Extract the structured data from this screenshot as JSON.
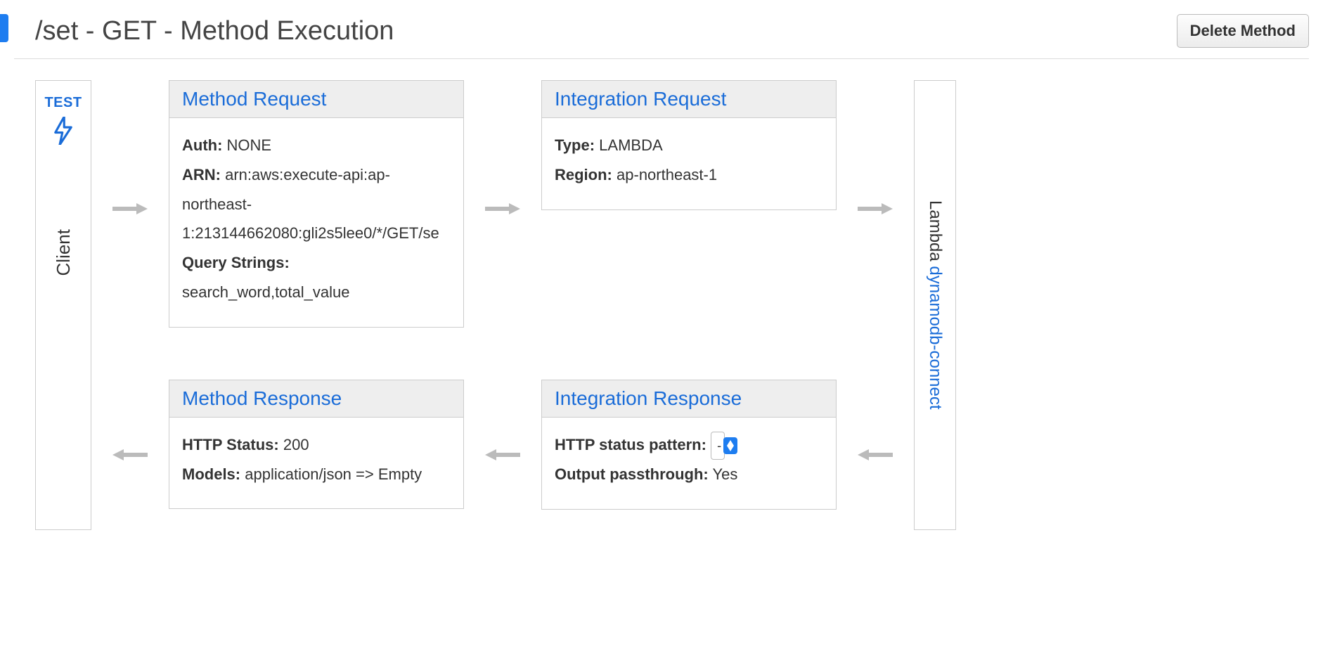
{
  "header": {
    "title": "/set - GET - Method Execution",
    "delete_label": "Delete Method"
  },
  "client": {
    "test_label": "TEST",
    "label": "Client"
  },
  "lambda": {
    "prefix": "Lambda ",
    "link": "dynamodb-connect"
  },
  "method_request": {
    "title": "Method Request",
    "auth_label": "Auth:",
    "auth_value": "NONE",
    "arn_label": "ARN:",
    "arn_value": "arn:aws:execute-api:ap-northeast-1:213144662080:gli2s5lee0/*/GET/se",
    "qs_label": "Query Strings:",
    "qs_value": "search_word,total_value"
  },
  "integration_request": {
    "title": "Integration Request",
    "type_label": "Type:",
    "type_value": "LAMBDA",
    "region_label": "Region:",
    "region_value": "ap-northeast-1"
  },
  "method_response": {
    "title": "Method Response",
    "status_label": "HTTP Status:",
    "status_value": "200",
    "models_label": "Models:",
    "models_value": "application/json => Empty"
  },
  "integration_response": {
    "title": "Integration Response",
    "pattern_label": "HTTP status pattern:",
    "pattern_value": "-",
    "passthrough_label": "Output passthrough:",
    "passthrough_value": "Yes"
  }
}
